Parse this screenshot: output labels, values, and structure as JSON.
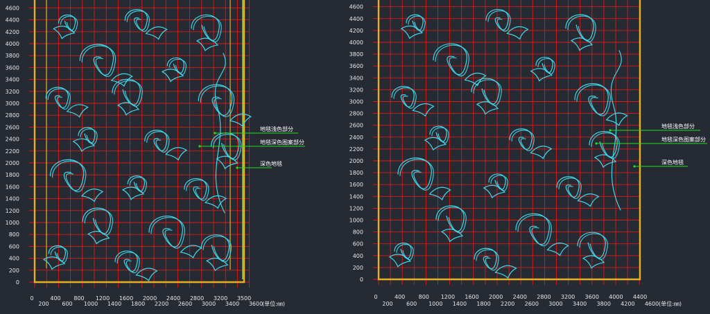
{
  "colors": {
    "background": "#252a33",
    "grid": "#e01818",
    "frame_outer": "#e8b020",
    "frame_inner": "#9acd32",
    "pattern": "#40d8e8",
    "leader": "#20e020",
    "text": "#e8e8e8"
  },
  "panels": [
    {
      "y_ticks": [
        "0",
        "200",
        "400",
        "600",
        "800",
        "1000",
        "1200",
        "1400",
        "1600",
        "1800",
        "2000",
        "2200",
        "2400",
        "2600",
        "2800",
        "3000",
        "3200",
        "3400",
        "3600",
        "3800",
        "4000",
        "4200",
        "4400",
        "4600"
      ],
      "x_ticks_top": [
        "0",
        "400",
        "800",
        "1200",
        "1600",
        "2000",
        "2400",
        "2800",
        "3200",
        "3500"
      ],
      "x_ticks_bottom": [
        "200",
        "600",
        "1000",
        "1400",
        "1800",
        "2200",
        "2600",
        "3000",
        "3400",
        "3600"
      ],
      "unit_label": "(单位:㎜)",
      "callouts": [
        {
          "text": "地毯浅色部分"
        },
        {
          "text": "地毯深色图案部分"
        },
        {
          "text": "深色地毯"
        }
      ]
    },
    {
      "y_ticks": [
        "0",
        "200",
        "400",
        "600",
        "800",
        "1000",
        "1200",
        "1400",
        "1600",
        "1800",
        "2000",
        "2200",
        "2400",
        "2600",
        "2800",
        "3000",
        "3200",
        "3400",
        "3600",
        "3800",
        "4000",
        "4200",
        "4400",
        "4600"
      ],
      "x_ticks_top": [
        "0",
        "400",
        "800",
        "1200",
        "1600",
        "2000",
        "2400",
        "2800",
        "3200",
        "3600",
        "4000",
        "4400"
      ],
      "x_ticks_bottom": [
        "200",
        "600",
        "1000",
        "1400",
        "1800",
        "2200",
        "2600",
        "3000",
        "3400",
        "3800",
        "4200",
        "4600"
      ],
      "unit_label": "(单位:㎜)",
      "callouts": [
        {
          "text": "地毯浅色部分"
        },
        {
          "text": "地毯深色图案部分"
        },
        {
          "text": "深色地毯"
        }
      ]
    }
  ]
}
